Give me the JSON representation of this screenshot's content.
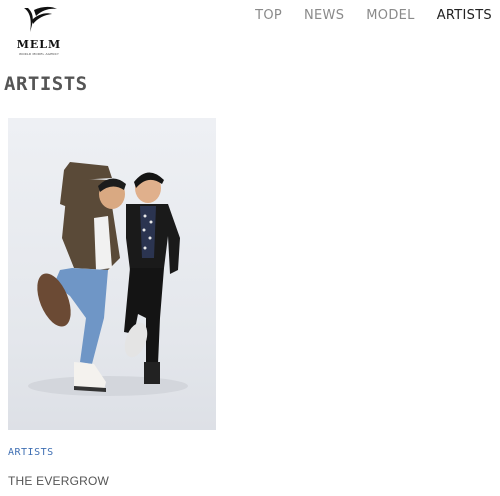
{
  "brand": {
    "name": "MELM",
    "tagline": "WORLD MODEL AGENCY",
    "logo_icon": "swoosh-logo"
  },
  "nav": {
    "items": [
      {
        "label": "TOP",
        "active": false
      },
      {
        "label": "NEWS",
        "active": false
      },
      {
        "label": "MODEL",
        "active": false
      },
      {
        "label": "ARTISTS",
        "active": true
      }
    ]
  },
  "page": {
    "title": "ARTISTS"
  },
  "card": {
    "category": "ARTISTS",
    "title": "THE EVERGROW",
    "image": "photo-of-two-men-posing"
  },
  "colors": {
    "accent": "#3f6fb3",
    "nav_active": "#222222",
    "nav_inactive": "#8a8a8a"
  }
}
